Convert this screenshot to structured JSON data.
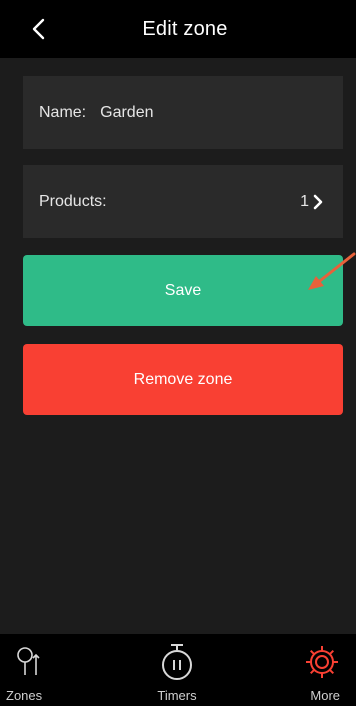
{
  "header": {
    "title": "Edit zone",
    "back_icon": "chevron-left-icon"
  },
  "form": {
    "name_label": "Name:",
    "name_value": "Garden",
    "products_label": "Products:",
    "products_count": "1",
    "products_icon": "chevron-right-icon"
  },
  "buttons": {
    "save_label": "Save",
    "remove_label": "Remove zone"
  },
  "tabbar": {
    "zones_label": "Zones",
    "timers_label": "Timers",
    "more_label": "More"
  },
  "colors": {
    "save": "#2fbb88",
    "remove": "#f94033",
    "accent": "#f94033",
    "annotation_arrow": "#e8613a",
    "background": "#1c1c1c",
    "card": "#2a2a2a"
  }
}
